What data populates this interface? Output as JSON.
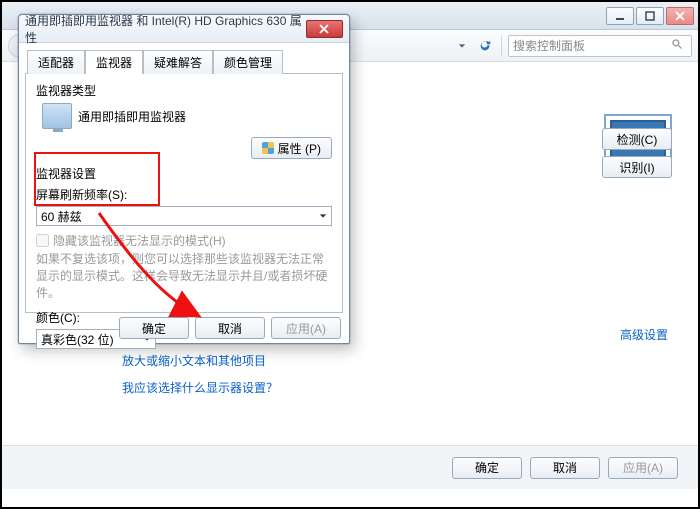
{
  "parent": {
    "search_placeholder": "搜索控制面板",
    "rightButtons": {
      "detect": "检测(C)",
      "identify": "识别(I)"
    },
    "advanced_link": "高级设置",
    "bottom_links": {
      "resize_text": "放大或缩小文本和其他项目",
      "which_settings": "我应该选择什么显示器设置？"
    },
    "footer": {
      "ok": "确定",
      "cancel": "取消",
      "apply": "应用(A)"
    }
  },
  "dialog": {
    "title": "通用即插即用监视器 和 Intel(R) HD Graphics 630 属性",
    "tabs": {
      "adapter": "适配器",
      "monitor": "监视器",
      "troubleshoot": "疑难解答",
      "color": "颜色管理"
    },
    "monitorType": {
      "group": "监视器类型",
      "name": "通用即插即用监视器",
      "propertiesBtn": "属性 (P)"
    },
    "monitorSettings": {
      "group": "监视器设置",
      "refreshLabel": "屏幕刷新频率(S):",
      "refreshValue": "60 赫兹",
      "hideModesLabel": "隐藏该监视器无法显示的模式(H)",
      "hideModesNote": "如果不复选该项，则您可以选择那些该监视器无法正常显示的显示模式。这样会导致无法显示并且/或者损坏硬件。"
    },
    "color": {
      "label": "颜色(C):",
      "value": "真彩色(32 位)"
    },
    "footer": {
      "ok": "确定",
      "cancel": "取消",
      "apply": "应用(A)"
    }
  }
}
